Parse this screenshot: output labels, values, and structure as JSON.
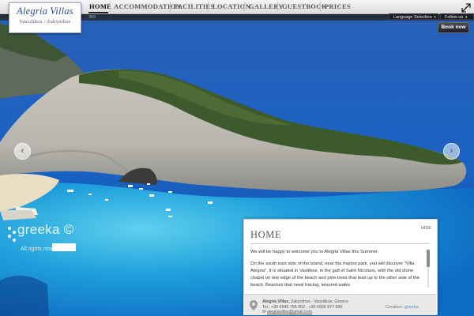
{
  "logo": {
    "title": "Alegria Villas",
    "subtitle": "Vassilikos / Zakynthos"
  },
  "nav": [
    {
      "label": "HOME",
      "active": true
    },
    {
      "label": "ACCOMMODATION",
      "active": false
    },
    {
      "label": "FACILITIES",
      "active": false
    },
    {
      "label": "LOCATION",
      "active": false
    },
    {
      "label": "GALLERY",
      "active": false
    },
    {
      "label": "GUESTBOOK",
      "active": false
    },
    {
      "label": "PRICES",
      "active": false
    }
  ],
  "topbar": {
    "strip_text": "360",
    "language_label": "Language Selection",
    "follow_label": "Follow us"
  },
  "book_now": "Book now",
  "watermark": {
    "brand": "greeka",
    "rights": "All rights reserved"
  },
  "panel": {
    "title": "HOME",
    "hide_label": "HIDE",
    "paragraphs": [
      "We will be happy to welcome you to Alegria Villas this Summer.",
      "On the south east side of the island, near the marine park, you will discover \"Villa Alegria\". It is situated in Vasilikos, in the gulf of Saint Nicolaos, with the old stone chapel on one edge of the beach and pine trees that lead up to the other side of the beach. Beaches that need tracing, leisured walks"
    ]
  },
  "contact": {
    "name": "Alegria Villas",
    "location": ", Zakynthos - Vassilikos, Greece",
    "tel": "Tel.: +30 6945 755 052 , +30 6936 977 590",
    "email": "alegriavillas@gmail.com"
  },
  "creation": {
    "label": "Creation:",
    "logo": "greeka"
  },
  "icons": {
    "expand": "expand-icon",
    "prev": "chevron-left-icon",
    "next": "chevron-right-icon",
    "pin": "location-pin-icon"
  },
  "colors": {
    "brand_blue": "#2b4f97",
    "sea": "#1565c0",
    "lagoon": "#29a6d8"
  }
}
